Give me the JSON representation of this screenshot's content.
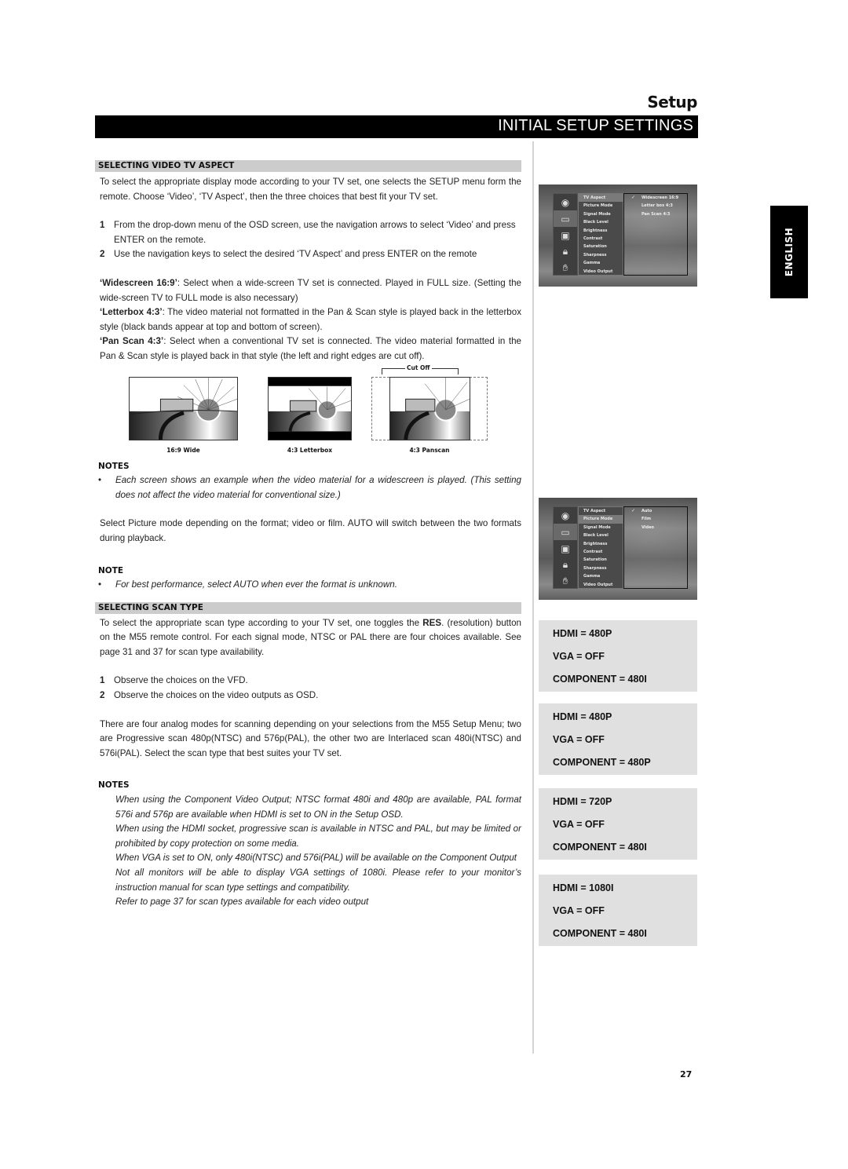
{
  "header": {
    "section": "Setup",
    "title": "INITIAL SETUP SETTINGS",
    "language_tab": "ENGLISH"
  },
  "tv_aspect": {
    "heading": "SELECTING VIDEO TV ASPECT",
    "intro": "To select the appropriate display mode according to your TV set, one selects the SETUP menu form the remote. Choose ‘Video’, ‘TV Aspect’, then the three choices that best fit your TV set.",
    "steps": [
      {
        "num": "1",
        "text": "From the drop-down menu of the OSD screen, use the navigation arrows to select ‘Video’ and press ENTER on the remote."
      },
      {
        "num": "2",
        "text": "Use the navigation keys to select the desired ‘TV Aspect’ and press ENTER on the remote"
      }
    ],
    "options": [
      {
        "term": "‘Widescreen 16:9’",
        "text": ": Select when a wide-screen TV set is connected. Played in FULL size. (Setting the wide-screen TV to FULL mode is also necessary)"
      },
      {
        "term": "‘Letterbox 4:3’",
        "text": ": The video material not formatted in the Pan & Scan style is played back in the letterbox style (black bands appear at top and bottom of screen)."
      },
      {
        "term": "‘Pan Scan 4:3’",
        "text": ": Select when a conventional TV set is connected. The video material formatted in the Pan & Scan style is played back in that style (the left and right edges are cut off)."
      }
    ],
    "figures": {
      "cut_off_label": "Cut Off",
      "labels": [
        "16:9 Wide",
        "4:3 Letterbox",
        "4:3 Panscan"
      ]
    },
    "notes_heading": "NOTES",
    "notes": [
      "Each screen shows an example when the video material for a widescreen is played. (This setting does not affect the video material for conventional size.)"
    ]
  },
  "picture_mode": {
    "text": "Select Picture mode depending on the format; video or film.   AUTO will switch between the two formats during playback.",
    "note_heading": "NOTE",
    "note": "For best performance, select AUTO when ever the format is unknown."
  },
  "scan_type": {
    "heading": "SELECTING SCAN TYPE",
    "intro_pre": "To select the appropriate scan type according to your TV set, one toggles the ",
    "intro_bold": "RES",
    "intro_post": ". (resolution) button on the M55 remote control. For each signal mode, NTSC or PAL there are four choices available. See page 31 and 37 for scan type availability.",
    "steps": [
      {
        "num": "1",
        "text": "Observe the choices on the VFD."
      },
      {
        "num": "2",
        "text": "Observe the choices on the video outputs as OSD."
      }
    ],
    "modes_text": "There are four analog modes for scanning depending on your selections from the M55 Setup Menu; two are Progressive scan 480p(NTSC) and 576p(PAL), the other two are Interlaced scan 480i(NTSC) and 576i(PAL). Select the scan type that best suites your TV set.",
    "notes_heading": "NOTES",
    "notes": [
      "When using the Component Video Output; NTSC format 480i and 480p are available, PAL format 576i and 576p are available when HDMI is set to ON in the Setup OSD.",
      "When using the HDMI socket, progressive scan is available in NTSC and PAL, but may be limited or prohibited by copy protection on some media.",
      "When VGA is set to ON, only 480i(NTSC) and 576i(PAL) will be available on the Component Output",
      "Not all monitors will be able to display VGA settings of 1080i.  Please refer to your monitor’s instruction manual for scan type settings and compatibility.",
      "Refer to page 37 for scan types available for each video output"
    ]
  },
  "osd_menus": [
    {
      "menu_items": [
        "TV Aspect",
        "Picture Mode",
        "Signal Mode",
        "Black Level",
        "Brightness",
        "Contrast",
        "Saturation",
        "Sharpness",
        "Gamma",
        "Video Output"
      ],
      "selected_item": "TV Aspect",
      "sub_options": [
        "Widescreen 16:9",
        "Letter box 4:3",
        "Pan Scan 4:3"
      ],
      "checked_option": "Widescreen 16:9",
      "check_mark": "✓"
    },
    {
      "menu_items": [
        "TV Aspect",
        "Picture Mode",
        "Signal Mode",
        "Black Level",
        "Brightness",
        "Contrast",
        "Saturation",
        "Sharpness",
        "Gamma",
        "Video Output"
      ],
      "selected_item": "Picture Mode",
      "sub_options": [
        "Auto",
        "Film",
        "Video"
      ],
      "checked_option": "Auto",
      "check_mark": "✓"
    }
  ],
  "osd_icons": [
    "globe-icon",
    "tv-screen-icon",
    "speaker-icon",
    "padlock-icon",
    "hand-remote-icon"
  ],
  "scan_settings": [
    {
      "hdmi": "HDMI = 480P",
      "vga": "VGA = OFF",
      "component": "COMPONENT = 480I"
    },
    {
      "hdmi": "HDMI = 480P",
      "vga": "VGA = OFF",
      "component": "COMPONENT = 480P"
    },
    {
      "hdmi": "HDMI = 720P",
      "vga": "VGA = OFF",
      "component": "COMPONENT = 480I"
    },
    {
      "hdmi": "HDMI = 1080I",
      "vga": "VGA = OFF",
      "component": "COMPONENT = 480I"
    }
  ],
  "page_number": "27"
}
